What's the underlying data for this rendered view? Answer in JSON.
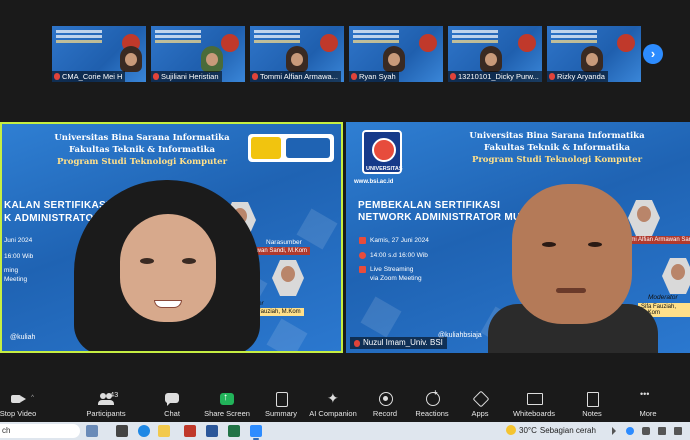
{
  "thumbnails": [
    {
      "name": "CMA_Corie Mei H",
      "muted": true
    },
    {
      "name": "Sujiliani Heristian",
      "muted": true
    },
    {
      "name": "Tommi Alfian Armawa...",
      "muted": true
    },
    {
      "name": "Ryan Syah",
      "muted": true
    },
    {
      "name": "13210101_Dicky Purw...",
      "muted": true
    },
    {
      "name": "Rizky Aryanda",
      "muted": true
    }
  ],
  "next_page_icon": "chevron-right-icon",
  "banner": {
    "univ": "Universitas Bina Sarana Informatika",
    "faculty": "Fakultas Teknik & Informatika",
    "program": "Program Studi Teknologi Komputer",
    "event_line1": "PEMBEKALAN SERTIFIKASI",
    "event_line2": "NETWORK ADMINISTRATOR MUDA",
    "left_event_line1": "KALAN SERTIFIKASI",
    "left_event_line2": "K ADMINISTRATOR M",
    "date": "Kamis, 27 Juni 2024",
    "left_date": "Juni 2024",
    "time": "14:00 s.d 16:00 Wib",
    "left_time": "16:00 Wib",
    "stream1": "Live Streaming",
    "stream2": "via Zoom Meeting",
    "left_stream1": "ming",
    "left_stream2": "Meeting",
    "narasumber": "Narasumber",
    "narasumber_name": "Tommi Alfian Armawan Sandi, M.Kom",
    "left_narasumber_name": "ian Armawan Sandi, M.Kom",
    "moderator": "Moderator",
    "moderator_name": "Sifa Fauziah, M.Kom",
    "left_moderator_name": "Fauziah, M.Kom",
    "instagram": "@kuliahbsiaja",
    "left_instagram": "@kuliah",
    "url": "www.bsi.ac.id",
    "logo_text": "UNIVERSITAS"
  },
  "tiles": {
    "right_name": "Nuzul Imam_Univ. BSI",
    "right_muted": true
  },
  "toolbar": [
    {
      "label": "Stop Video",
      "icon": "video-icon"
    },
    {
      "label": "Participants",
      "icon": "participants-icon",
      "count": "43"
    },
    {
      "label": "Chat",
      "icon": "chat-icon"
    },
    {
      "label": "Share Screen",
      "icon": "share-screen-icon"
    },
    {
      "label": "Summary",
      "icon": "summary-icon"
    },
    {
      "label": "AI Companion",
      "icon": "ai-companion-icon"
    },
    {
      "label": "Record",
      "icon": "record-icon"
    },
    {
      "label": "Reactions",
      "icon": "reactions-icon"
    },
    {
      "label": "Apps",
      "icon": "apps-icon"
    },
    {
      "label": "Whiteboards",
      "icon": "whiteboards-icon"
    },
    {
      "label": "Notes",
      "icon": "notes-icon"
    },
    {
      "label": "More",
      "icon": "more-icon"
    }
  ],
  "taskbar": {
    "search_text": "ch",
    "weather_temp": "30°C",
    "weather_desc": "Sebagian cerah",
    "accent": "#2d8cff",
    "active_speaker_border": "#c6ee42"
  }
}
